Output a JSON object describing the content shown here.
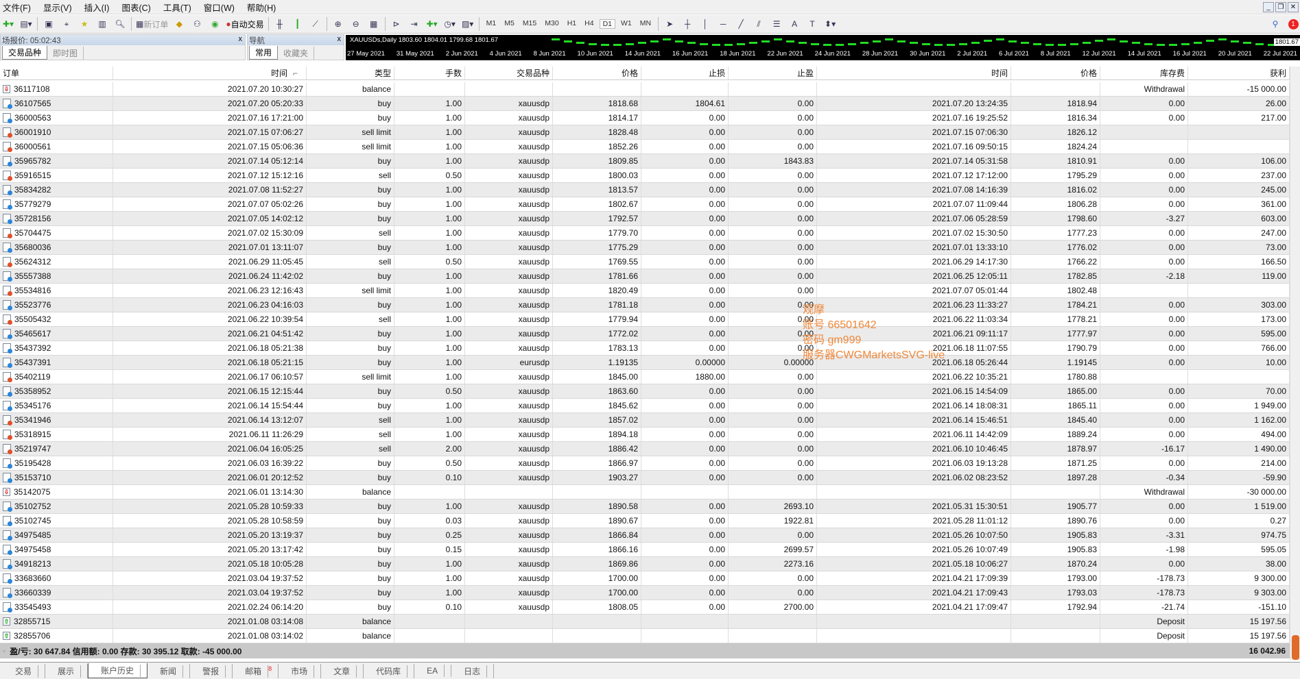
{
  "menu": [
    "文件(F)",
    "显示(V)",
    "插入(I)",
    "图表(C)",
    "工具(T)",
    "窗口(W)",
    "帮助(H)"
  ],
  "toolbar": {
    "new_order": "新订单",
    "auto_trade": "自动交易",
    "timeframes": [
      "M1",
      "M5",
      "M15",
      "M30",
      "H1",
      "H4",
      "D1",
      "W1",
      "MN"
    ],
    "active_timeframe": "D1",
    "notification_count": "1"
  },
  "market_watch": {
    "title": "场报价: 05:02:43",
    "tabs": [
      "交易品种",
      "即时图"
    ]
  },
  "navigator": {
    "title": "导航",
    "tabs": [
      "常用",
      "收藏夹"
    ]
  },
  "chart": {
    "label": "XAUUSDs,Daily  1803.60 1804.01 1799.68 1801.67",
    "price": "1801.67",
    "dates": [
      "27 May 2021",
      "31 May 2021",
      "2 Jun 2021",
      "4 Jun 2021",
      "8 Jun 2021",
      "10 Jun 2021",
      "14 Jun 2021",
      "16 Jun 2021",
      "18 Jun 2021",
      "22 Jun 2021",
      "24 Jun 2021",
      "28 Jun 2021",
      "30 Jun 2021",
      "2 Jul 2021",
      "6 Jul 2021",
      "8 Jul 2021",
      "12 Jul 2021",
      "14 Jul 2021",
      "16 Jul 2021",
      "20 Jul 2021",
      "22 Jul 2021"
    ],
    "candle_color": "#22dd22"
  },
  "table": {
    "columns": [
      "订单",
      "时间",
      "类型",
      "手数",
      "交易品种",
      "价格",
      "止损",
      "止盈",
      "时间",
      "价格",
      "库存费",
      "获利"
    ],
    "sort_indicator": "⌐",
    "rows": [
      [
        "36117108",
        "2021.07.20 10:30:27",
        "balance",
        "",
        "",
        "",
        "",
        "",
        "",
        "",
        "Withdrawal",
        "-15 000.00",
        "bdown"
      ],
      [
        "36107565",
        "2021.07.20 05:20:33",
        "buy",
        "1.00",
        "xauusdp",
        "1818.68",
        "1804.61",
        "0.00",
        "2021.07.20 13:24:35",
        "1818.94",
        "0.00",
        "26.00",
        "buy"
      ],
      [
        "36000563",
        "2021.07.16 17:21:00",
        "buy",
        "1.00",
        "xauusdp",
        "1814.17",
        "0.00",
        "0.00",
        "2021.07.16 19:25:52",
        "1816.34",
        "0.00",
        "217.00",
        "buy"
      ],
      [
        "36001910",
        "2021.07.15 07:06:27",
        "sell limit",
        "1.00",
        "xauusdp",
        "1828.48",
        "0.00",
        "0.00",
        "2021.07.15 07:06:30",
        "1826.12",
        "",
        "",
        "sell"
      ],
      [
        "36000561",
        "2021.07.15 05:06:36",
        "sell limit",
        "1.00",
        "xauusdp",
        "1852.26",
        "0.00",
        "0.00",
        "2021.07.16 09:50:15",
        "1824.24",
        "",
        "",
        "sell"
      ],
      [
        "35965782",
        "2021.07.14 05:12:14",
        "buy",
        "1.00",
        "xauusdp",
        "1809.85",
        "0.00",
        "1843.83",
        "2021.07.14 05:31:58",
        "1810.91",
        "0.00",
        "106.00",
        "buy"
      ],
      [
        "35916515",
        "2021.07.12 15:12:16",
        "sell",
        "0.50",
        "xauusdp",
        "1800.03",
        "0.00",
        "0.00",
        "2021.07.12 17:12:00",
        "1795.29",
        "0.00",
        "237.00",
        "sell"
      ],
      [
        "35834282",
        "2021.07.08 11:52:27",
        "buy",
        "1.00",
        "xauusdp",
        "1813.57",
        "0.00",
        "0.00",
        "2021.07.08 14:16:39",
        "1816.02",
        "0.00",
        "245.00",
        "buy"
      ],
      [
        "35779279",
        "2021.07.07 05:02:26",
        "buy",
        "1.00",
        "xauusdp",
        "1802.67",
        "0.00",
        "0.00",
        "2021.07.07 11:09:44",
        "1806.28",
        "0.00",
        "361.00",
        "buy"
      ],
      [
        "35728156",
        "2021.07.05 14:02:12",
        "buy",
        "1.00",
        "xauusdp",
        "1792.57",
        "0.00",
        "0.00",
        "2021.07.06 05:28:59",
        "1798.60",
        "-3.27",
        "603.00",
        "buy"
      ],
      [
        "35704475",
        "2021.07.02 15:30:09",
        "sell",
        "1.00",
        "xauusdp",
        "1779.70",
        "0.00",
        "0.00",
        "2021.07.02 15:30:50",
        "1777.23",
        "0.00",
        "247.00",
        "sell"
      ],
      [
        "35680036",
        "2021.07.01 13:11:07",
        "buy",
        "1.00",
        "xauusdp",
        "1775.29",
        "0.00",
        "0.00",
        "2021.07.01 13:33:10",
        "1776.02",
        "0.00",
        "73.00",
        "buy"
      ],
      [
        "35624312",
        "2021.06.29 11:05:45",
        "sell",
        "0.50",
        "xauusdp",
        "1769.55",
        "0.00",
        "0.00",
        "2021.06.29 14:17:30",
        "1766.22",
        "0.00",
        "166.50",
        "sell"
      ],
      [
        "35557388",
        "2021.06.24 11:42:02",
        "buy",
        "1.00",
        "xauusdp",
        "1781.66",
        "0.00",
        "0.00",
        "2021.06.25 12:05:11",
        "1782.85",
        "-2.18",
        "119.00",
        "buy"
      ],
      [
        "35534816",
        "2021.06.23 12:16:43",
        "sell limit",
        "1.00",
        "xauusdp",
        "1820.49",
        "0.00",
        "0.00",
        "2021.07.07 05:01:44",
        "1802.48",
        "",
        "",
        "sell"
      ],
      [
        "35523776",
        "2021.06.23 04:16:03",
        "buy",
        "1.00",
        "xauusdp",
        "1781.18",
        "0.00",
        "0.00",
        "2021.06.23 11:33:27",
        "1784.21",
        "0.00",
        "303.00",
        "buy"
      ],
      [
        "35505432",
        "2021.06.22 10:39:54",
        "sell",
        "1.00",
        "xauusdp",
        "1779.94",
        "0.00",
        "0.00",
        "2021.06.22 11:03:34",
        "1778.21",
        "0.00",
        "173.00",
        "sell"
      ],
      [
        "35465617",
        "2021.06.21 04:51:42",
        "buy",
        "1.00",
        "xauusdp",
        "1772.02",
        "0.00",
        "0.00",
        "2021.06.21 09:11:17",
        "1777.97",
        "0.00",
        "595.00",
        "buy"
      ],
      [
        "35437392",
        "2021.06.18 05:21:38",
        "buy",
        "1.00",
        "xauusdp",
        "1783.13",
        "0.00",
        "0.00",
        "2021.06.18 11:07:55",
        "1790.79",
        "0.00",
        "766.00",
        "buy"
      ],
      [
        "35437391",
        "2021.06.18 05:21:15",
        "buy",
        "1.00",
        "eurusdp",
        "1.19135",
        "0.00000",
        "0.00000",
        "2021.06.18 05:26:44",
        "1.19145",
        "0.00",
        "10.00",
        "buy"
      ],
      [
        "35402119",
        "2021.06.17 06:10:57",
        "sell limit",
        "1.00",
        "xauusdp",
        "1845.00",
        "1880.00",
        "0.00",
        "2021.06.22 10:35:21",
        "1780.88",
        "",
        "",
        "sell"
      ],
      [
        "35358952",
        "2021.06.15 12:15:44",
        "buy",
        "0.50",
        "xauusdp",
        "1863.60",
        "0.00",
        "0.00",
        "2021.06.15 14:54:09",
        "1865.00",
        "0.00",
        "70.00",
        "buy"
      ],
      [
        "35345176",
        "2021.06.14 15:54:44",
        "buy",
        "1.00",
        "xauusdp",
        "1845.62",
        "0.00",
        "0.00",
        "2021.06.14 18:08:31",
        "1865.11",
        "0.00",
        "1 949.00",
        "buy"
      ],
      [
        "35341946",
        "2021.06.14 13:12:07",
        "sell",
        "1.00",
        "xauusdp",
        "1857.02",
        "0.00",
        "0.00",
        "2021.06.14 15:46:51",
        "1845.40",
        "0.00",
        "1 162.00",
        "sell"
      ],
      [
        "35318915",
        "2021.06.11 11:26:29",
        "sell",
        "1.00",
        "xauusdp",
        "1894.18",
        "0.00",
        "0.00",
        "2021.06.11 14:42:09",
        "1889.24",
        "0.00",
        "494.00",
        "sell"
      ],
      [
        "35219747",
        "2021.06.04 16:05:25",
        "sell",
        "2.00",
        "xauusdp",
        "1886.42",
        "0.00",
        "0.00",
        "2021.06.10 10:46:45",
        "1878.97",
        "-16.17",
        "1 490.00",
        "sell"
      ],
      [
        "35195428",
        "2021.06.03 16:39:22",
        "buy",
        "0.50",
        "xauusdp",
        "1866.97",
        "0.00",
        "0.00",
        "2021.06.03 19:13:28",
        "1871.25",
        "0.00",
        "214.00",
        "buy"
      ],
      [
        "35153710",
        "2021.06.01 20:12:52",
        "buy",
        "0.10",
        "xauusdp",
        "1903.27",
        "0.00",
        "0.00",
        "2021.06.02 08:23:52",
        "1897.28",
        "-0.34",
        "-59.90",
        "buy"
      ],
      [
        "35142075",
        "2021.06.01 13:14:30",
        "balance",
        "",
        "",
        "",
        "",
        "",
        "",
        "",
        "Withdrawal",
        "-30 000.00",
        "bdown"
      ],
      [
        "35102752",
        "2021.05.28 10:59:33",
        "buy",
        "1.00",
        "xauusdp",
        "1890.58",
        "0.00",
        "2693.10",
        "2021.05.31 15:30:51",
        "1905.77",
        "0.00",
        "1 519.00",
        "buy"
      ],
      [
        "35102745",
        "2021.05.28 10:58:59",
        "buy",
        "0.03",
        "xauusdp",
        "1890.67",
        "0.00",
        "1922.81",
        "2021.05.28 11:01:12",
        "1890.76",
        "0.00",
        "0.27",
        "buy"
      ],
      [
        "34975485",
        "2021.05.20 13:19:37",
        "buy",
        "0.25",
        "xauusdp",
        "1866.84",
        "0.00",
        "0.00",
        "2021.05.26 10:07:50",
        "1905.83",
        "-3.31",
        "974.75",
        "buy"
      ],
      [
        "34975458",
        "2021.05.20 13:17:42",
        "buy",
        "0.15",
        "xauusdp",
        "1866.16",
        "0.00",
        "2699.57",
        "2021.05.26 10:07:49",
        "1905.83",
        "-1.98",
        "595.05",
        "buy"
      ],
      [
        "34918213",
        "2021.05.18 10:05:28",
        "buy",
        "1.00",
        "xauusdp",
        "1869.86",
        "0.00",
        "2273.16",
        "2021.05.18 10:06:27",
        "1870.24",
        "0.00",
        "38.00",
        "buy"
      ],
      [
        "33683660",
        "2021.03.04 19:37:52",
        "buy",
        "1.00",
        "xauusdp",
        "1700.00",
        "0.00",
        "0.00",
        "2021.04.21 17:09:39",
        "1793.00",
        "-178.73",
        "9 300.00",
        "buy"
      ],
      [
        "33660339",
        "2021.03.04 19:37:52",
        "buy",
        "1.00",
        "xauusdp",
        "1700.00",
        "0.00",
        "0.00",
        "2021.04.21 17:09:43",
        "1793.03",
        "-178.73",
        "9 303.00",
        "buy"
      ],
      [
        "33545493",
        "2021.02.24 06:14:20",
        "buy",
        "0.10",
        "xauusdp",
        "1808.05",
        "0.00",
        "2700.00",
        "2021.04.21 17:09:47",
        "1792.94",
        "-21.74",
        "-151.10",
        "buy"
      ],
      [
        "32855715",
        "2021.01.08 03:14:08",
        "balance",
        "",
        "",
        "",
        "",
        "",
        "",
        "",
        "Deposit",
        "15 197.56",
        "bup"
      ],
      [
        "32855706",
        "2021.01.08 03:14:02",
        "balance",
        "",
        "",
        "",
        "",
        "",
        "",
        "",
        "Deposit",
        "15 197.56",
        "bup"
      ]
    ]
  },
  "summary": {
    "text": "盈/亏: 30 647.84  信用额: 0.00  存款: 30 395.12  取款: -45 000.00",
    "total": "16 042.96"
  },
  "bottom_tabs": [
    "交易",
    "展示",
    "账户历史",
    "新闻",
    "警报",
    "邮箱",
    "市场",
    "文章",
    "代码库",
    "EA",
    "日志"
  ],
  "active_bottom_tab": "账户历史",
  "mailbox_count": "8",
  "watermark": [
    "观摩",
    "账号 66501642",
    "密码 gm999",
    "服务器CWGMarketsSVG-live"
  ],
  "colors": {
    "watermark": "#f0883a",
    "row_alt": "#ebebeb",
    "buy_icon": "#2a86d8",
    "sell_icon": "#e0502a"
  }
}
